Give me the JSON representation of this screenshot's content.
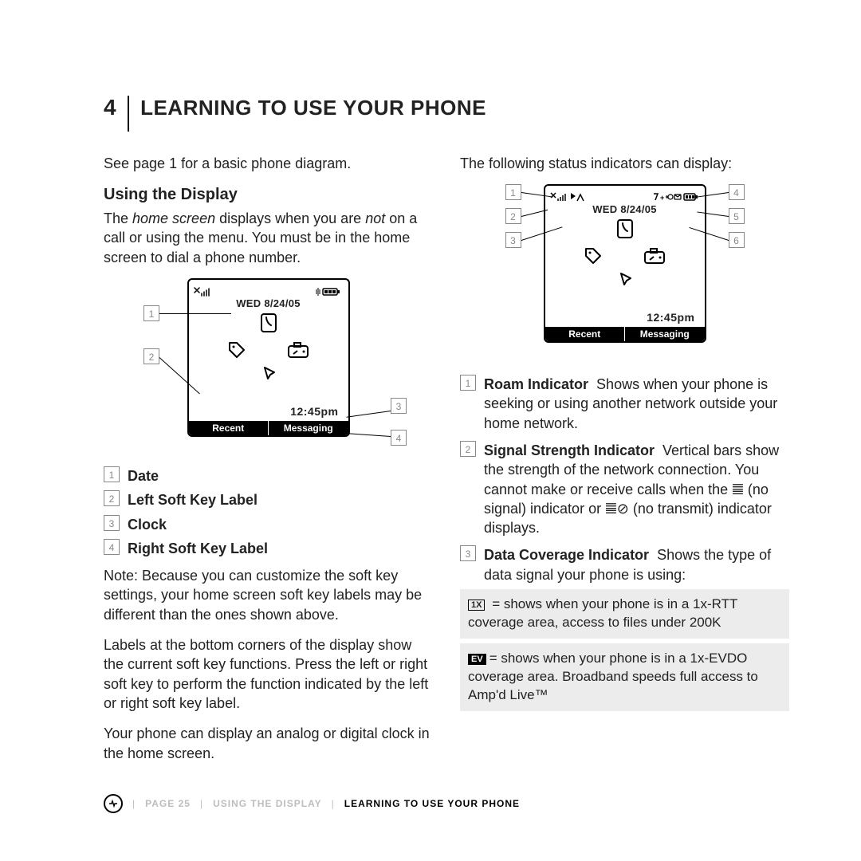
{
  "chapter": {
    "number": "4",
    "title": "LEARNING TO USE YOUR PHONE"
  },
  "left": {
    "see_ref": "See page 1 for a basic phone diagram.",
    "section": "Using the Display",
    "intro_a": "The ",
    "intro_term": "home screen",
    "intro_b": " displays when you are ",
    "intro_not": "not",
    "intro_c": " on a call or using the menu. You must be in the home screen to dial a phone number.",
    "callouts": [
      {
        "n": "1",
        "label": "Date"
      },
      {
        "n": "2",
        "label": "Left Soft Key Label"
      },
      {
        "n": "3",
        "label": "Clock"
      },
      {
        "n": "4",
        "label": "Right Soft Key Label"
      }
    ],
    "note": "Note: Because you can customize the soft key settings, your home screen soft key labels may be different than the ones shown above.",
    "p2": "Labels at the bottom corners of the display show the current soft key functions. Press the left or right soft key to perform the function indicated by the left or right soft key label.",
    "p3": "Your phone can display an analog or digital clock in the home screen."
  },
  "right": {
    "lead": "The following status indicators can display:",
    "defs": [
      {
        "n": "1",
        "term": "Roam Indicator",
        "desc": "Shows when your phone is seeking or using another network outside your home network."
      },
      {
        "n": "2",
        "term": "Signal Strength Indicator",
        "desc": "Vertical bars show the strength of the network connection. You cannot make or receive calls when the 𝍤 (no signal) indicator or 𝍤⊘ (no transmit) indicator displays."
      },
      {
        "n": "3",
        "term": "Data Coverage Indicator",
        "desc": "Shows the type of data signal your phone is using:"
      }
    ],
    "box1_chip": "1X",
    "box1_text": " = shows when your phone is in a 1x-RTT coverage area, access to files under 200K",
    "box2_chip": "EV",
    "box2_text": "= shows when your phone is in a 1x-EVDO coverage area. Broadband speeds full access to Amp'd Live™"
  },
  "phone": {
    "date": "WED 8/24/05",
    "time": "12:45pm",
    "soft_left": "Recent",
    "soft_right": "Messaging"
  },
  "footer": {
    "page": "PAGE 25",
    "crumb1": "USING THE DISPLAY",
    "crumb2": "LEARNING TO USE YOUR PHONE"
  },
  "icons": {
    "signal": "signal-icon",
    "battery": "battery-icon",
    "vibrate": "vibrate-icon",
    "phone": "phone-icon",
    "tag": "tag-icon",
    "camera": "camera-icon",
    "pointer": "pointer-icon",
    "roam": "roam-icon",
    "data": "data-icon",
    "vm": "voicemail-icon"
  }
}
